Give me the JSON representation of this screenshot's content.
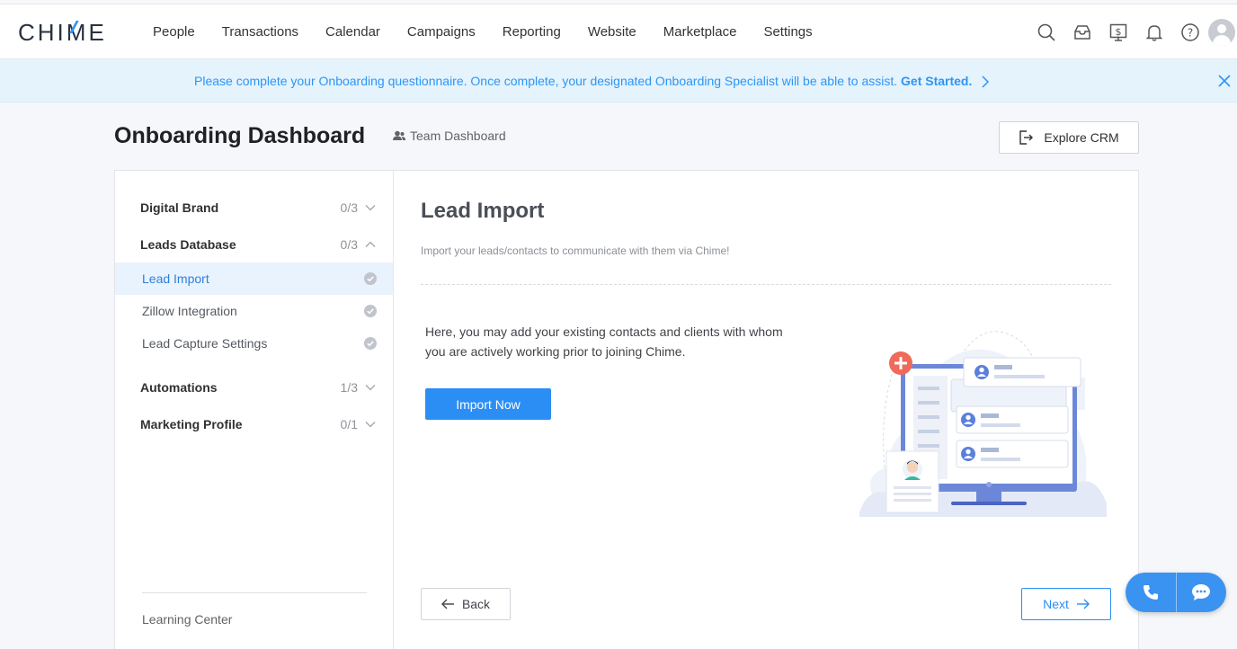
{
  "brand": {
    "logo": "CHIME",
    "accent": "#2f95f5"
  },
  "nav": {
    "items": [
      "People",
      "Transactions",
      "Calendar",
      "Campaigns",
      "Reporting",
      "Website",
      "Marketplace",
      "Settings"
    ],
    "icons": [
      "search-icon",
      "inbox-icon",
      "billing-icon",
      "bell-icon",
      "help-icon",
      "avatar"
    ]
  },
  "banner": {
    "message": "Please complete your Onboarding questionnaire. Once complete, your designated Onboarding Specialist will be able to assist.",
    "cta": "Get Started."
  },
  "header": {
    "title": "Onboarding Dashboard",
    "team_link": "Team Dashboard",
    "explore_button": "Explore CRM"
  },
  "sidebar": {
    "sections": [
      {
        "label": "Digital Brand",
        "count": "0/3"
      },
      {
        "label": "Leads Database",
        "count": "0/3"
      },
      {
        "label": "Automations",
        "count": "1/3"
      },
      {
        "label": "Marketing Profile",
        "count": "0/1"
      }
    ],
    "leads_items": [
      "Lead Import",
      "Zillow Integration",
      "Lead Capture Settings"
    ],
    "learning_center": "Learning Center"
  },
  "main": {
    "title": "Lead Import",
    "subtitle": "Import your leads/contacts to communicate with them via Chime!",
    "description": "Here, you may add your existing contacts and clients with whom you are actively working prior to joining Chime.",
    "import_button": "Import Now",
    "back_button": "Back",
    "next_button": "Next"
  }
}
